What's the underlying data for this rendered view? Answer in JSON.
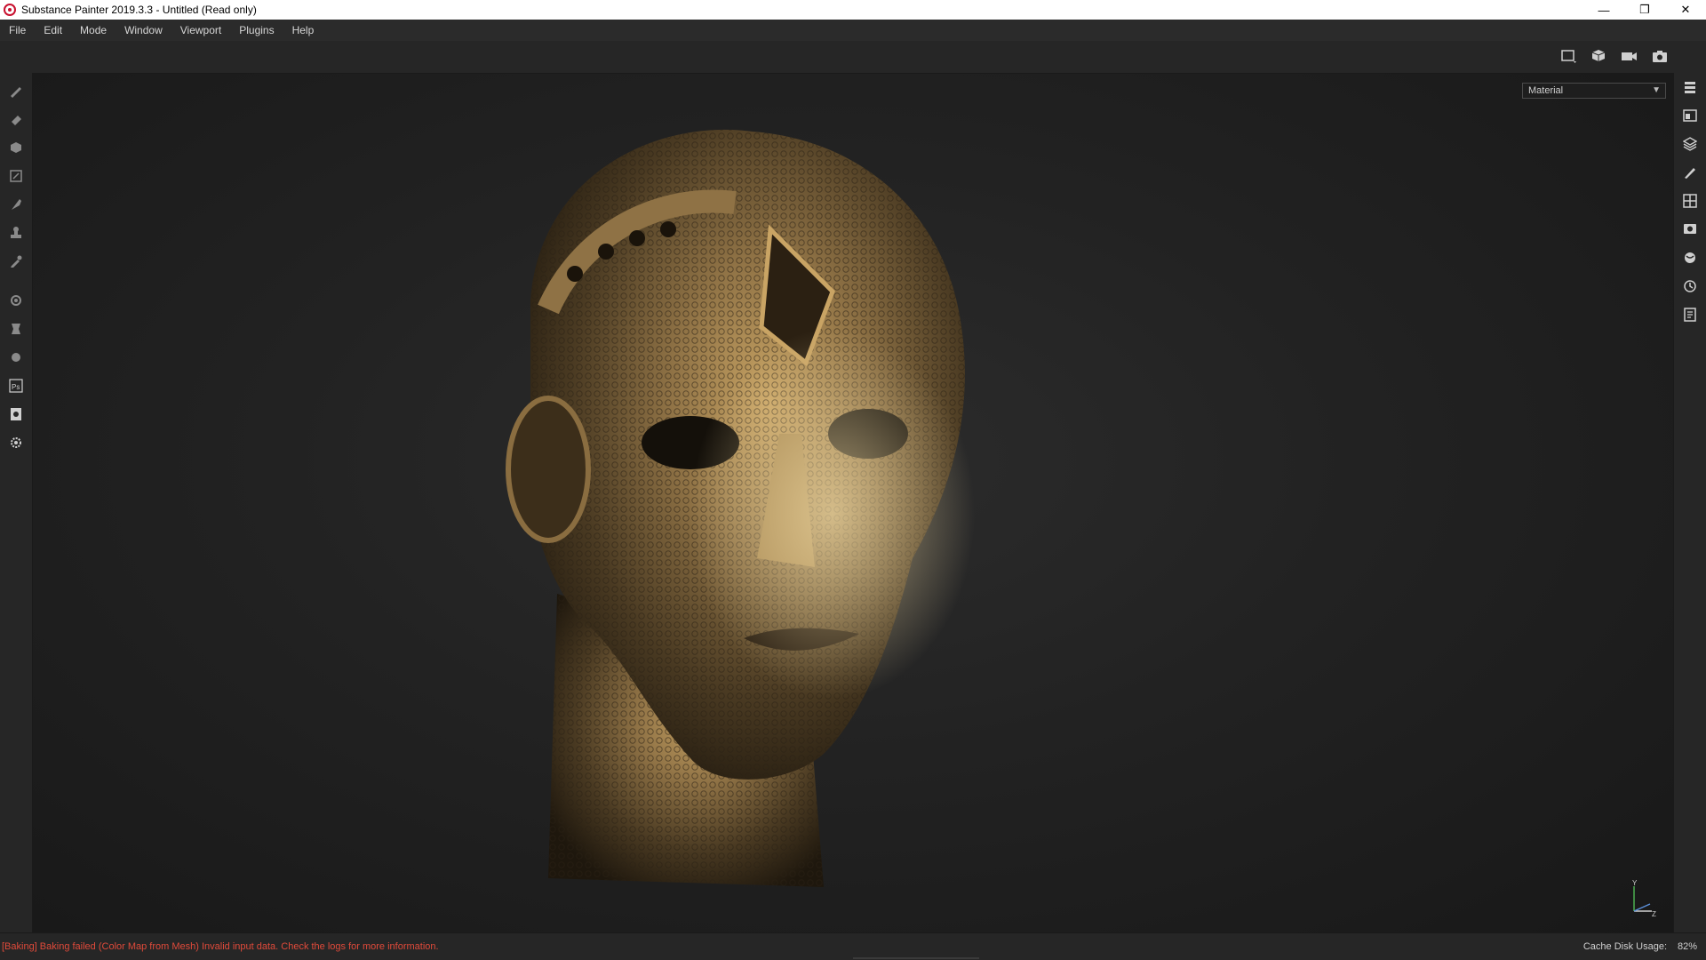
{
  "window": {
    "title": "Substance Painter 2019.3.3 - Untitled (Read only)",
    "minimize": "—",
    "maximize": "❐",
    "close": "✕"
  },
  "menu": [
    "File",
    "Edit",
    "Mode",
    "Window",
    "Viewport",
    "Plugins",
    "Help"
  ],
  "toolbar": {
    "icons": [
      "viewport-frame-icon",
      "3d-view-icon",
      "camera-mode-icon",
      "screenshot-icon"
    ]
  },
  "left_tools": [
    "paint-brush-icon",
    "eraser-icon",
    "projection-icon",
    "polygon-fill-icon",
    "smudge-icon",
    "clone-stamp-icon",
    "color-picker-icon",
    "bake-settings-icon",
    "physics-painter-icon",
    "iray-icon",
    "photoshop-export-icon",
    "export-textures-icon",
    "settings-gear-icon"
  ],
  "left_tools_misc": {
    "photoshop_glyph": "Ps"
  },
  "right_panels": [
    "layers-panel-icon",
    "texture-set-icon",
    "layer-stack-icon",
    "brush-properties-icon",
    "display-settings-icon",
    "viewer-settings-icon",
    "shelf-icon",
    "history-icon",
    "log-icon"
  ],
  "viewport": {
    "channel_select": "Material",
    "axis": {
      "y": "Y",
      "z": "Z"
    }
  },
  "status": {
    "message": "[Baking] Baking failed (Color Map from Mesh) Invalid input data. Check the logs for more information.",
    "cache_label": "Cache Disk Usage:",
    "cache_value": "82%",
    "progress": 0.0
  },
  "colors": {
    "error_text": "#e04a3a",
    "brand_red": "#c8102e",
    "bronze_light": "#c9a464",
    "bronze_dark": "#3a2c18"
  }
}
